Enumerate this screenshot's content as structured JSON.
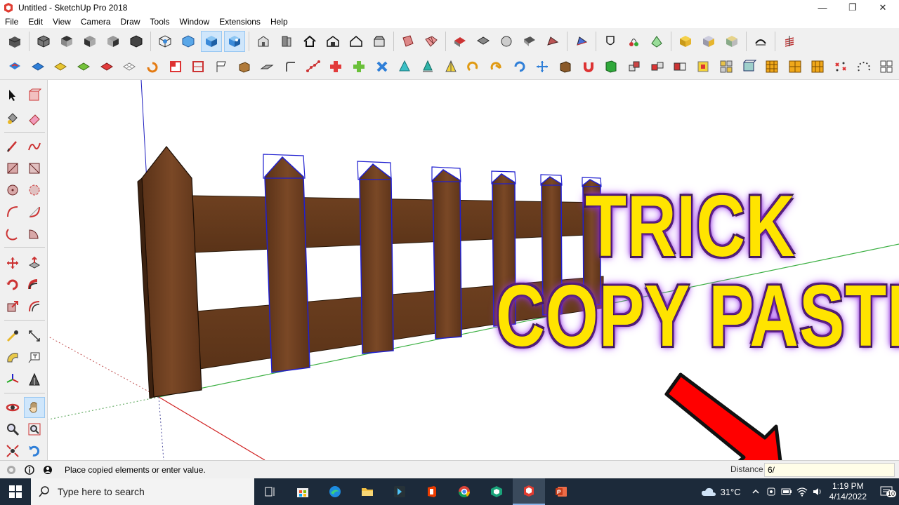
{
  "window": {
    "title": "Untitled - SketchUp Pro 2018",
    "controls": [
      "—",
      "❐",
      "✕"
    ]
  },
  "menu": [
    "File",
    "Edit",
    "View",
    "Camera",
    "Draw",
    "Tools",
    "Window",
    "Extensions",
    "Help"
  ],
  "overlay": {
    "line1": "TRICK",
    "line2": "COPY PASTE",
    "text_color": "#ffe400",
    "glow_color": "#8e2de2",
    "arrow_color": "#ff0000"
  },
  "status": {
    "message": "Place copied elements or enter value.",
    "measure_label": "Distance",
    "measure_value": "6/"
  },
  "taskbar": {
    "search_placeholder": "Type here to search",
    "weather_temp": "31°C",
    "time": "1:19 PM",
    "date": "4/14/2022",
    "notification_count": "10"
  },
  "colors": {
    "wood": "#6b3d1f",
    "selection": "#1f1fd0",
    "axis_green": "#3cb043",
    "axis_red": "#d02020",
    "axis_blue": "#2020c0",
    "taskbar": "#1c2a3a"
  }
}
